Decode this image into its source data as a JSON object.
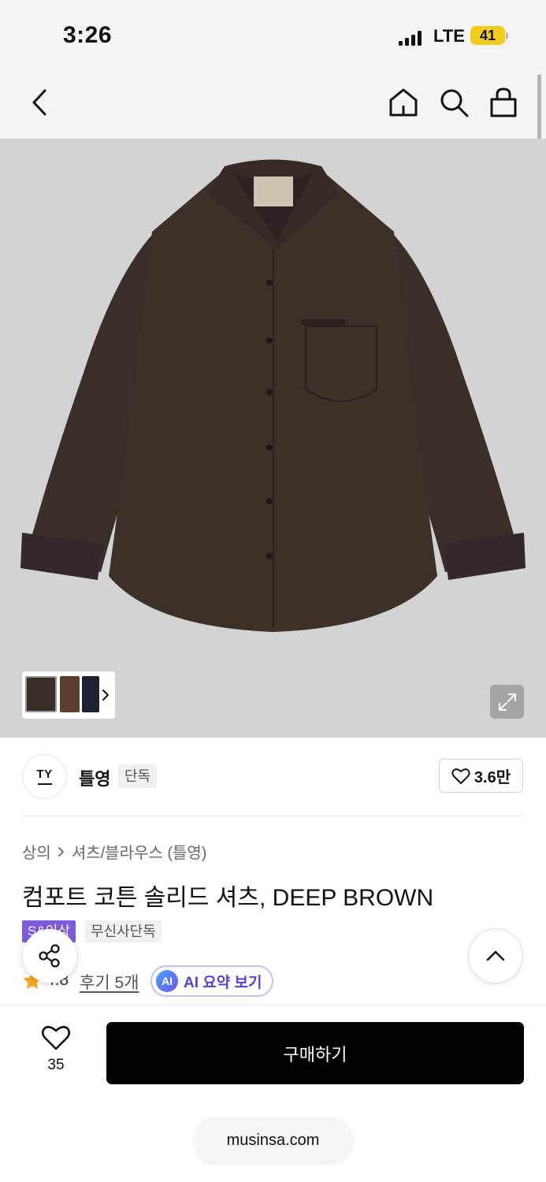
{
  "status_bar": {
    "time": "3:26",
    "network": "LTE",
    "battery": "41"
  },
  "nav": {
    "icons": [
      "back-arrow-icon",
      "home-icon",
      "search-icon",
      "shopping-bag-icon"
    ]
  },
  "product_image": {
    "alt": "Dark brown long-sleeve button shirt"
  },
  "brand": {
    "logo_text": "TY",
    "name": "틀영",
    "exclusive_badge": "단독",
    "like_count": "3.6만"
  },
  "product": {
    "breadcrumb": [
      "상의",
      "셔츠/블라우스 (틀영)"
    ],
    "title": "컴포트 코튼 솔리드 셔츠, DEEP BROWN",
    "tags": [
      "S&이상",
      "무신사단독"
    ],
    "rating": "4.8",
    "reviews": "후기 5개",
    "ai_badge": "AI",
    "ai_summary": "AI 요약 보기"
  },
  "bottom_bar": {
    "wish_count": "35",
    "buy_label": "구매하기"
  },
  "browser": {
    "url": "musinsa.com"
  },
  "colors": {
    "brown_shirt": "#3a2e29",
    "accent_purple": "#7c5cdb",
    "battery_yellow": "#f3cc1b",
    "star": "#f5a623"
  }
}
